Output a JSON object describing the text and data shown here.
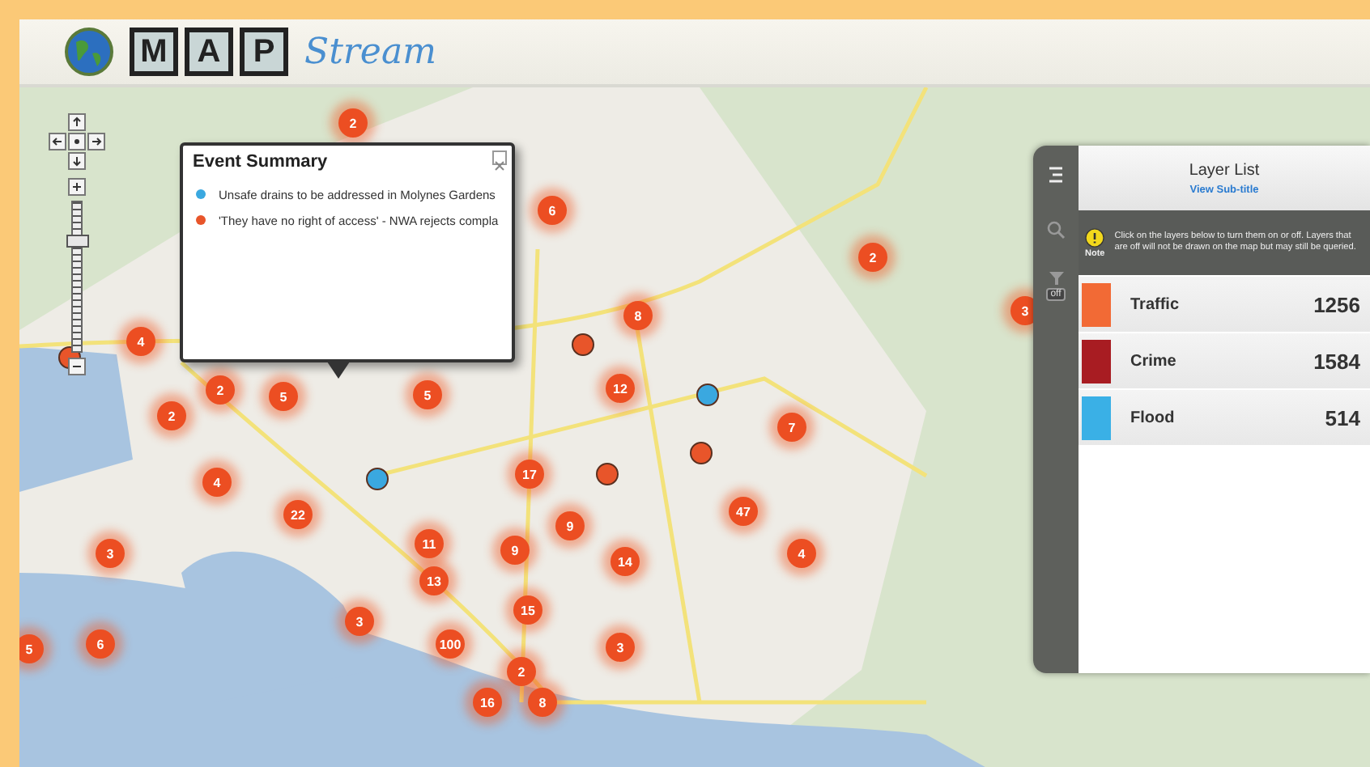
{
  "logo": {
    "letters": [
      "M",
      "A",
      "P"
    ],
    "script": "Stream"
  },
  "clusters": [
    {
      "count": "2"
    },
    {
      "count": "6"
    },
    {
      "count": "2"
    },
    {
      "count": "8"
    },
    {
      "count": "3"
    },
    {
      "count": "4"
    },
    {
      "count": "2"
    },
    {
      "count": "5"
    },
    {
      "count": "5"
    },
    {
      "count": "12"
    },
    {
      "count": "2"
    },
    {
      "count": "7"
    },
    {
      "count": "4"
    },
    {
      "count": "17"
    },
    {
      "count": "22"
    },
    {
      "count": "47"
    },
    {
      "count": "9"
    },
    {
      "count": "11"
    },
    {
      "count": "3"
    },
    {
      "count": "9"
    },
    {
      "count": "14"
    },
    {
      "count": "4"
    },
    {
      "count": "13"
    },
    {
      "count": "15"
    },
    {
      "count": "3"
    },
    {
      "count": "5"
    },
    {
      "count": "6"
    },
    {
      "count": "100"
    },
    {
      "count": "3"
    },
    {
      "count": "2"
    },
    {
      "count": "16"
    },
    {
      "count": "8"
    }
  ],
  "events": [
    {
      "color": "#e8552a"
    },
    {
      "color": "#e8552a"
    },
    {
      "color": "#e8552a"
    },
    {
      "color": "#e8552a"
    },
    {
      "color": "#3aa8e0"
    },
    {
      "color": "#3aa8e0"
    }
  ],
  "zoom": {
    "level": 0.75
  },
  "popup": {
    "title": "Event Summary",
    "items": [
      {
        "text": "Unsafe drains to be addressed in Molynes Gardens",
        "color": "#3aa8e0"
      },
      {
        "text": "'They have no right of access' - NWA rejects compla",
        "color": "#e8552a"
      }
    ]
  },
  "sidebar": {
    "filter_badge": "off"
  },
  "layer_list": {
    "title": "Layer List",
    "subtitle": "View Sub-title",
    "note_label": "Note",
    "note": "Click on the layers below to turn them on or off. Layers that are off will not be drawn on the map but may still be queried.",
    "layers": [
      {
        "name": "Traffic",
        "count": "1256",
        "color": "#f26a35"
      },
      {
        "name": "Crime",
        "count": "1584",
        "color": "#a81c22"
      },
      {
        "name": "Flood",
        "count": "514",
        "color": "#3ab0e6"
      }
    ]
  }
}
